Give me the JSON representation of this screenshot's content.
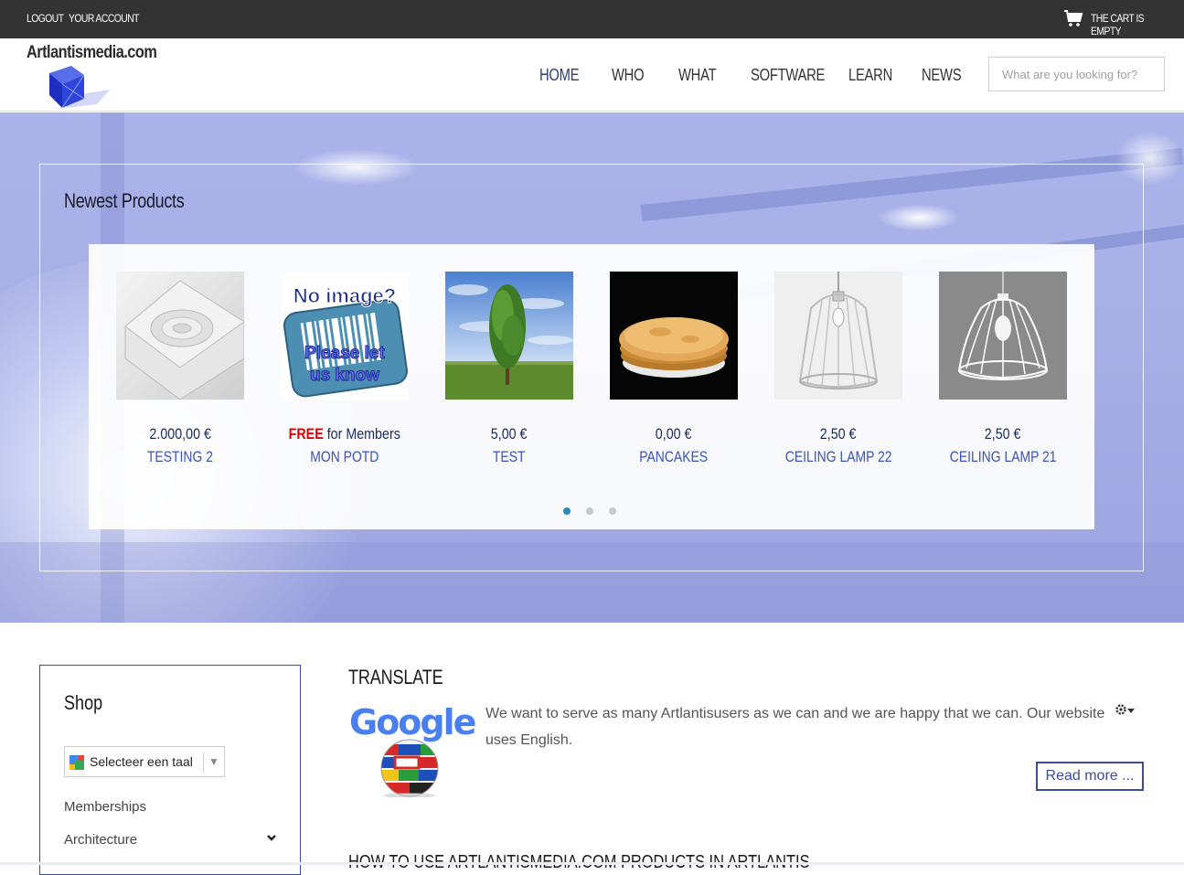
{
  "topbar": {
    "logout": "LOGOUT",
    "account": "YOUR ACCOUNT",
    "cart_icon": "cart-icon",
    "cart_text": "THE CART IS EMPTY"
  },
  "header": {
    "site_name": "Artlantismedia.com",
    "nav": [
      "HOME",
      "WHO",
      "WHAT",
      "SOFTWARE",
      "LEARN",
      "NEWS"
    ],
    "active_nav": "HOME",
    "search_placeholder": "What are you looking for?"
  },
  "newest": {
    "title": "Newest Products",
    "products": [
      {
        "price": "2.000,00 €",
        "name": "TESTING 2"
      },
      {
        "price_free": "FREE",
        "price_suffix": " for Members",
        "name": "MON POTD",
        "thumb_text_1": "No image?",
        "thumb_text_2": "Please let",
        "thumb_text_3": "us know"
      },
      {
        "price": "5,00 €",
        "name": "TEST"
      },
      {
        "price": "0,00 €",
        "name": "PANCAKES"
      },
      {
        "price": "2,50 €",
        "name": "CEILING LAMP 22"
      },
      {
        "price": "2,50 €",
        "name": "CEILING LAMP 21"
      }
    ],
    "pages": 3,
    "active_page": 1
  },
  "shop": {
    "title": "Shop",
    "language_select": "Selecteer een taal",
    "links": [
      "Memberships",
      "Architecture"
    ]
  },
  "translate": {
    "title": "TRANSLATE",
    "logo_text": "Google",
    "text": "We want to serve as many Artlantisusers as we can and we are happy that we can. Our website uses English.",
    "read_more": "Read more ..."
  },
  "next_section": {
    "title": "HOW TO USE ARTLANTISMEDIA.COM PRODUCTS IN ARTLANTIS"
  },
  "colors": {
    "topbar": "#333333",
    "accent": "#3b4aa8",
    "hero": "#a6afe6",
    "free": "#e00000"
  }
}
